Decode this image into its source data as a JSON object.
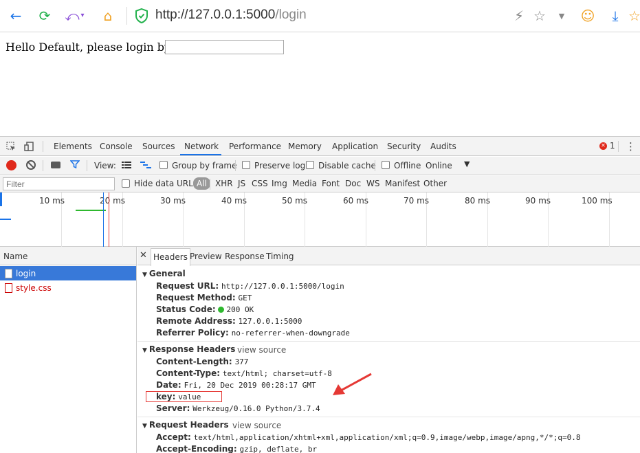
{
  "browser": {
    "url_host": "http://127.0.0.1:5000",
    "url_path": "/login",
    "icons": [
      "back-icon",
      "refresh-icon",
      "undo-icon",
      "home-icon",
      "shield-icon",
      "lightning-icon",
      "star-icon",
      "dropdown-icon",
      "smiley-icon",
      "download-icon",
      "star-icon"
    ]
  },
  "page": {
    "greeting": "Hello Default, please login by:",
    "input_value": ""
  },
  "devtools": {
    "tabs": [
      "Elements",
      "Console",
      "Sources",
      "Network",
      "Performance",
      "Memory",
      "Application",
      "Security",
      "Audits"
    ],
    "active_tab": "Network",
    "error_count": "1",
    "toolbar": {
      "view_label": "View:",
      "group_by_frame": "Group by frame",
      "preserve_log": "Preserve log",
      "disable_cache": "Disable cache",
      "offline": "Offline",
      "throttle": "Online"
    },
    "filter": {
      "placeholder": "Filter",
      "hide_data_urls": "Hide data URLs",
      "types": [
        "All",
        "XHR",
        "JS",
        "CSS",
        "Img",
        "Media",
        "Font",
        "Doc",
        "WS",
        "Manifest",
        "Other"
      ]
    },
    "timeline_labels": [
      "10 ms",
      "20 ms",
      "30 ms",
      "40 ms",
      "50 ms",
      "60 ms",
      "70 ms",
      "80 ms",
      "90 ms",
      "100 ms"
    ],
    "name_header": "Name",
    "requests": [
      {
        "name": "login"
      },
      {
        "name": "style.css"
      }
    ],
    "detail_tabs": [
      "Headers",
      "Preview",
      "Response",
      "Timing"
    ],
    "general": {
      "title": "General",
      "rows": [
        {
          "k": "Request URL:",
          "v": "http://127.0.0.1:5000/login"
        },
        {
          "k": "Request Method:",
          "v": "GET"
        },
        {
          "k": "Status Code:",
          "v": "200 OK"
        },
        {
          "k": "Remote Address:",
          "v": "127.0.0.1:5000"
        },
        {
          "k": "Referrer Policy:",
          "v": "no-referrer-when-downgrade"
        }
      ]
    },
    "response_headers": {
      "title": "Response Headers",
      "view_source": "view source",
      "rows": [
        {
          "k": "Content-Length:",
          "v": "377"
        },
        {
          "k": "Content-Type:",
          "v": "text/html; charset=utf-8"
        },
        {
          "k": "Date:",
          "v": "Fri, 20 Dec 2019 00:28:17 GMT"
        },
        {
          "k": "key:",
          "v": "value"
        },
        {
          "k": "Server:",
          "v": "Werkzeug/0.16.0 Python/3.7.4"
        }
      ]
    },
    "request_headers": {
      "title": "Request Headers",
      "view_source": "view source",
      "rows": [
        {
          "k": "Accept:",
          "v": "text/html,application/xhtml+xml,application/xml;q=0.9,image/webp,image/apng,*/*;q=0.8"
        },
        {
          "k": "Accept-Encoding:",
          "v": "gzip, deflate, br"
        }
      ]
    }
  }
}
